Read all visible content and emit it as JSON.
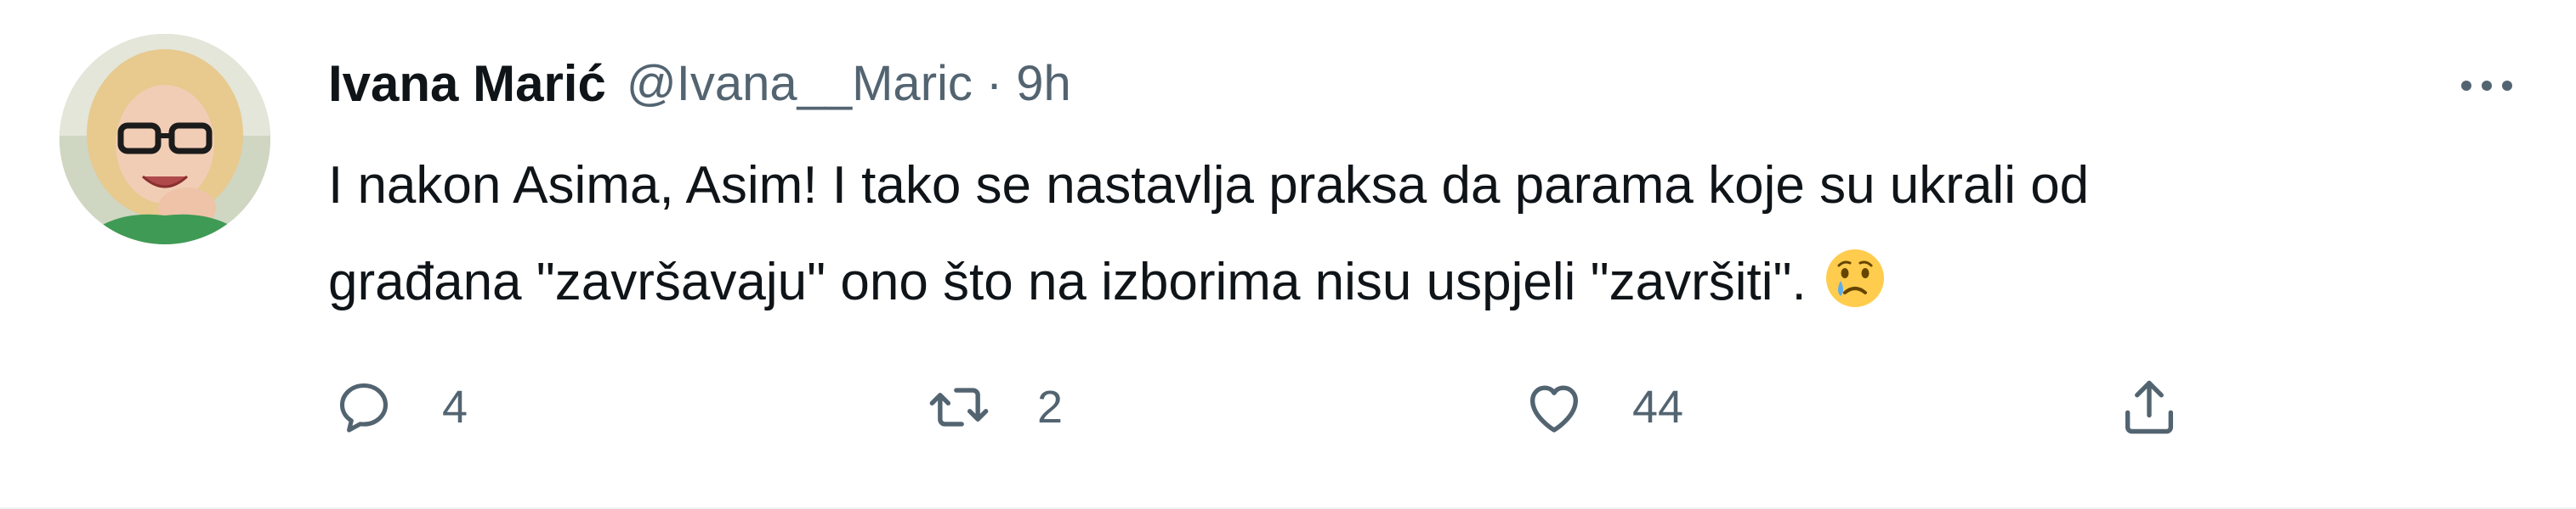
{
  "tweet": {
    "author_name": "Ivana Marić",
    "author_handle": "@Ivana__Maric",
    "separator": "·",
    "time": "9h",
    "text_line1": "I nakon Asima, Asim! I tako se nastavlja praksa da parama koje su ukrali od",
    "text_line2": "građana \"završavaju\" ono što na izborima nisu uspjeli \"završiti\".",
    "emoji": "crying-face-emoji"
  },
  "actions": {
    "reply_count": "4",
    "retweet_count": "2",
    "like_count": "44"
  },
  "icons": {
    "more": "more-horizontal-icon",
    "reply": "reply-bubble-icon",
    "retweet": "retweet-icon",
    "like": "heart-icon",
    "share": "share-icon"
  },
  "colors": {
    "text_primary": "#0f1419",
    "text_secondary": "#536471",
    "divider": "#eff3f4"
  }
}
